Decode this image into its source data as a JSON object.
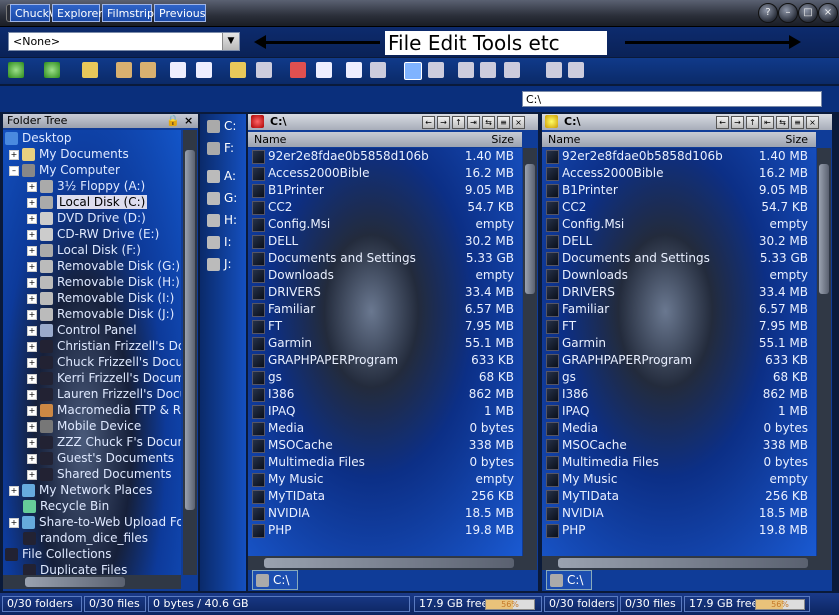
{
  "window": {
    "title": "C:\\"
  },
  "address_combo": {
    "value": "<None>"
  },
  "annotation": {
    "text": "File Edit Tools etc"
  },
  "tabs": [
    {
      "label": "Chuck"
    },
    {
      "label": "Explorer"
    },
    {
      "label": "Filmstrip"
    },
    {
      "label": "Previous"
    }
  ],
  "address_bar": {
    "value": "C:\\"
  },
  "folder_tree": {
    "title": "Folder Tree",
    "nodes": [
      {
        "label": "Desktop"
      },
      {
        "label": "My Documents"
      },
      {
        "label": "My Computer"
      },
      {
        "label": "3½ Floppy (A:)"
      },
      {
        "label": "Local Disk (C:)"
      },
      {
        "label": "DVD Drive (D:)"
      },
      {
        "label": "CD-RW Drive (E:)"
      },
      {
        "label": "Local Disk (F:)"
      },
      {
        "label": "Removable Disk (G:)"
      },
      {
        "label": "Removable Disk (H:)"
      },
      {
        "label": "Removable Disk (I:)"
      },
      {
        "label": "Removable Disk (J:)"
      },
      {
        "label": "Control Panel"
      },
      {
        "label": "Christian Frizzell's Documents"
      },
      {
        "label": "Chuck Frizzell's Documents"
      },
      {
        "label": "Kerri Frizzell's Documents"
      },
      {
        "label": "Lauren Frizzell's Documents"
      },
      {
        "label": "Macromedia FTP & RDS"
      },
      {
        "label": "Mobile Device"
      },
      {
        "label": "ZZZ Chuck F's Documents"
      },
      {
        "label": "Guest's Documents"
      },
      {
        "label": "Shared Documents"
      },
      {
        "label": "My Network Places"
      },
      {
        "label": "Recycle Bin"
      },
      {
        "label": "Share-to-Web Upload Folder"
      },
      {
        "label": "random_dice_files"
      },
      {
        "label": "File Collections"
      },
      {
        "label": "Duplicate Files"
      }
    ]
  },
  "drives": [
    "C:",
    "F:",
    "A:",
    "G:",
    "H:",
    "I:",
    "J:"
  ],
  "panes": [
    {
      "title": "C:\\",
      "tab": "C:\\"
    },
    {
      "title": "C:\\",
      "tab": "C:\\"
    }
  ],
  "columns": {
    "name": "Name",
    "size": "Size"
  },
  "files": [
    {
      "name": "92er2e8fdae0b5858d106b",
      "size": "1.40 MB"
    },
    {
      "name": "Access2000Bible",
      "size": "16.2 MB"
    },
    {
      "name": "B1Printer",
      "size": "9.05 MB"
    },
    {
      "name": "CC2",
      "size": "54.7 KB"
    },
    {
      "name": "Config.Msi",
      "size": "empty"
    },
    {
      "name": "DELL",
      "size": "30.2 MB"
    },
    {
      "name": "Documents and Settings",
      "size": "5.33 GB"
    },
    {
      "name": "Downloads",
      "size": "empty"
    },
    {
      "name": "DRIVERS",
      "size": "33.4 MB"
    },
    {
      "name": "Familiar",
      "size": "6.57 MB"
    },
    {
      "name": "FT",
      "size": "7.95 MB"
    },
    {
      "name": "Garmin",
      "size": "55.1 MB"
    },
    {
      "name": "GRAPHPAPERProgram",
      "size": "633 KB"
    },
    {
      "name": "gs",
      "size": "68 KB"
    },
    {
      "name": "I386",
      "size": "862 MB"
    },
    {
      "name": "IPAQ",
      "size": "1 MB"
    },
    {
      "name": "Media",
      "size": "0 bytes"
    },
    {
      "name": "MSOCache",
      "size": "338 MB"
    },
    {
      "name": "Multimedia Files",
      "size": "0 bytes"
    },
    {
      "name": "My Music",
      "size": "empty"
    },
    {
      "name": "MyTIData",
      "size": "256 KB"
    },
    {
      "name": "NVIDIA",
      "size": "18.5 MB"
    },
    {
      "name": "PHP",
      "size": "19.8 MB"
    }
  ],
  "status": {
    "folders_left": "0/30 folders",
    "files_left": "0/30 files",
    "bytes": "0 bytes / 40.6 GB",
    "free_left": "17.9 GB free",
    "pct_left": "56%",
    "folders_right": "0/30 folders",
    "files_right": "0/30 files",
    "free_right": "17.9 GB free",
    "pct_right": "56%"
  },
  "colors": {
    "panel_blue": "#0f3c98",
    "accent": "#1355c8"
  }
}
